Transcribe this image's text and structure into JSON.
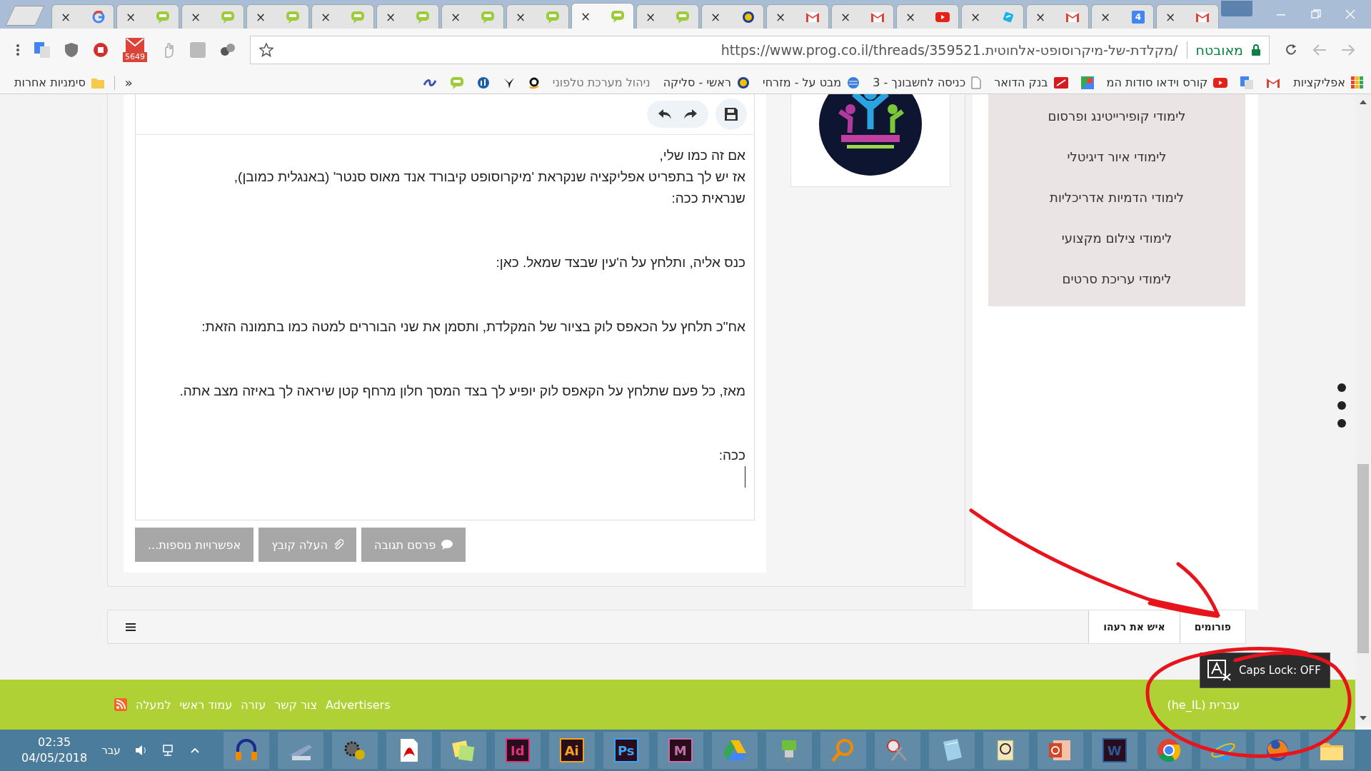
{
  "browser": {
    "tabs": [
      {
        "kind": "gmail",
        "close": "×",
        "selected": false
      },
      {
        "kind": "calendar",
        "close": "×",
        "badge": "4",
        "selected": false
      },
      {
        "kind": "gmail",
        "close": "×",
        "selected": false
      },
      {
        "kind": "cyan",
        "close": "×",
        "selected": false
      },
      {
        "kind": "youtube",
        "close": "×",
        "selected": false
      },
      {
        "kind": "gmail",
        "close": "×",
        "selected": false
      },
      {
        "kind": "gmail",
        "close": "×",
        "selected": false
      },
      {
        "kind": "site",
        "close": "×",
        "selected": false
      },
      {
        "kind": "prog",
        "close": "×",
        "selected": false
      },
      {
        "kind": "prog",
        "close": "×",
        "selected": true
      },
      {
        "kind": "prog",
        "close": "×",
        "selected": false
      },
      {
        "kind": "prog",
        "close": "×",
        "selected": false
      },
      {
        "kind": "prog",
        "close": "×",
        "selected": false
      },
      {
        "kind": "prog",
        "close": "×",
        "selected": false
      },
      {
        "kind": "prog",
        "close": "×",
        "selected": false
      },
      {
        "kind": "prog",
        "close": "×",
        "selected": false
      },
      {
        "kind": "prog",
        "close": "×",
        "selected": false
      },
      {
        "kind": "google",
        "close": "×",
        "selected": false
      }
    ],
    "security_label": "מאובטח",
    "url": "https://www.prog.co.il/threads/359521.מקלדת-של-מיקרוסופט-אלחוטית/",
    "mail_badge": "5649",
    "bookmarks": [
      {
        "kind": "apps",
        "label": "אפליקציות"
      },
      {
        "kind": "gmail"
      },
      {
        "kind": "translate"
      },
      {
        "kind": "youtube",
        "label": "קורס וידאו סודות המ"
      },
      {
        "kind": "maps"
      },
      {
        "kind": "bank",
        "label": "בנק הדואר"
      },
      {
        "kind": "page",
        "label": "כניסה לחשבונך - 3"
      },
      {
        "kind": "globe",
        "label": "מבט על - מזרחי"
      },
      {
        "kind": "circle",
        "label": "ראשי - סליקה"
      },
      {
        "kind": "none",
        "label": "ניהול מערכת טלפוני"
      },
      {
        "kind": "amazon"
      },
      {
        "kind": "bird"
      },
      {
        "kind": "stats"
      },
      {
        "kind": "prog"
      },
      {
        "kind": "swirl"
      }
    ],
    "more_bookmarks": "»",
    "other_bookmarks": "סימניות אחרות"
  },
  "editor": {
    "paragraphs": [
      [
        "אם זה כמו שלי,",
        "אז יש לך בתפריט אפליקציה שנקראת 'מיקרוסופט קיבורד אנד מאוס סנטר' (באנגלית כמובן),",
        "שנראית ככה:"
      ],
      [
        "כנס אליה, ותלחץ על ה'עין שבצד שמאל. כאן:"
      ],
      [
        "אח\"כ תלחץ על הכאפס לוק בציור של המקלדת, ותסמן את שני הבוררים למטה כמו בתמונה הזאת:"
      ],
      [
        "מאז, כל פעם שתלחץ על הקאפס לוק יופיע לך בצד המסך חלון מרחף קטן שיראה לך באיזה מצב אתה."
      ],
      [
        "ככה:"
      ]
    ],
    "buttons": [
      {
        "kind": "post",
        "label": "פרסם תגובה"
      },
      {
        "kind": "upload",
        "label": "העלה קובץ"
      },
      {
        "kind": "more",
        "label": "אפשרויות נוספות..."
      }
    ]
  },
  "sidebar": {
    "items": [
      "לימודי קופירייטינג ופרסום",
      "לימודי איור דיגיטלי",
      "לימודי הדמיות אדריכליות",
      "לימודי צילום מקצועי",
      "לימודי עריכת סרטים"
    ]
  },
  "breadcrumbs": [
    "פורומים",
    "איש את רעהו"
  ],
  "footer": {
    "language": "עברית (he_IL)",
    "links": [
      "Advertisers",
      "צור קשר",
      "עזרה",
      "עמוד ראשי",
      "למעלה"
    ]
  },
  "caps_lock_popup": "Caps Lock: OFF",
  "taskbar": {
    "time": "02:35",
    "date": "04/05/2018",
    "language": "עבר",
    "apps": [
      {
        "kind": "folder"
      },
      {
        "kind": "firefox"
      },
      {
        "kind": "ie"
      },
      {
        "kind": "chrome"
      },
      {
        "kind": "letter",
        "text": "W",
        "color": "#2b5797"
      },
      {
        "kind": "powerpoint"
      },
      {
        "kind": "viewer"
      },
      {
        "kind": "notepad"
      },
      {
        "kind": "scissors"
      },
      {
        "kind": "search"
      },
      {
        "kind": "plug"
      },
      {
        "kind": "drive"
      },
      {
        "kind": "letter",
        "text": "M",
        "color": "#c76fa8"
      },
      {
        "kind": "letter",
        "text": "Ps",
        "color": "#3ba3f5"
      },
      {
        "kind": "letter",
        "text": "Ai",
        "color": "#f7a01b"
      },
      {
        "kind": "letter",
        "text": "Id",
        "color": "#e0317a"
      },
      {
        "kind": "notes"
      },
      {
        "kind": "pdf"
      },
      {
        "kind": "gears"
      },
      {
        "kind": "scanner"
      },
      {
        "kind": "headphones"
      }
    ]
  }
}
